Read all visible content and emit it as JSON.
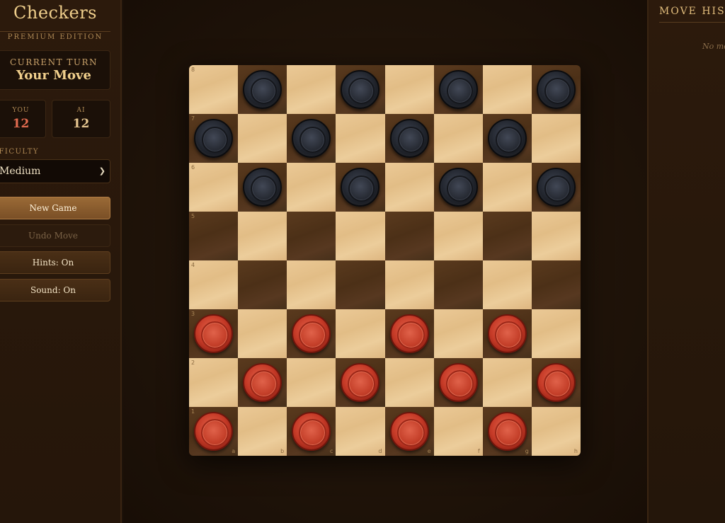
{
  "sidebar": {
    "title": "Checkers",
    "edition": "PREMIUM EDITION",
    "turn": {
      "label": "CURRENT TURN",
      "value": "Your Move"
    },
    "score": {
      "you_label": "YOU",
      "you_value": "12",
      "ai_label": "AI",
      "ai_value": "12"
    },
    "difficulty": {
      "label": "FFICULTY",
      "selected": "Medium"
    },
    "buttons": {
      "new_game": "New Game",
      "undo": "Undo Move",
      "hints": "Hints: On",
      "sound": "Sound: On"
    }
  },
  "board": {
    "files": [
      "a",
      "b",
      "c",
      "d",
      "e",
      "f",
      "g",
      "h"
    ],
    "ranks": [
      "8",
      "7",
      "6",
      "5",
      "4",
      "3",
      "2",
      "1"
    ],
    "rows": [
      ". b . b . b . b",
      "b . b . b . b .",
      ". b . b . b . b",
      ". . . . . . . .",
      ". . . . . . . .",
      "r . r . r . r .",
      ". r . r . r . r",
      "r . r . r . r ."
    ],
    "colors": {
      "light": "#e6c28d",
      "dark": "#4f3219",
      "black_piece": "#262a33",
      "red_piece": "#c53a27"
    }
  },
  "history": {
    "title": "MOVE HIST",
    "empty": "No mo"
  }
}
